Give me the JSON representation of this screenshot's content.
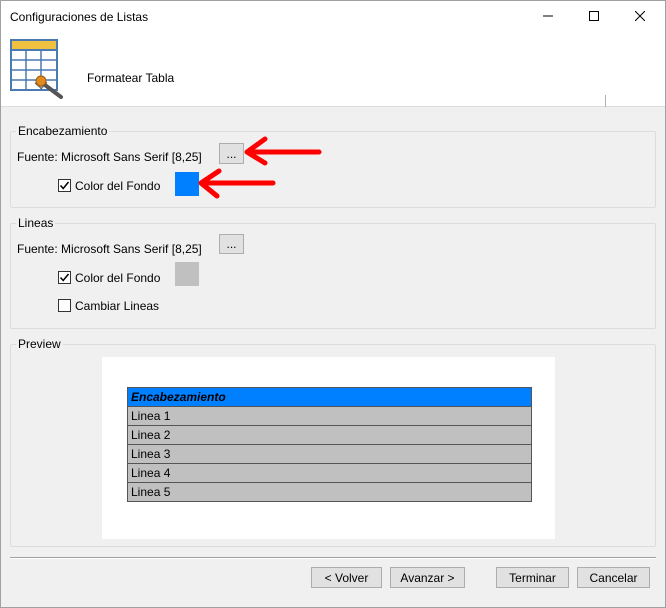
{
  "window": {
    "title": "Configuraciones de Listas",
    "header_title": "Formatear Tabla"
  },
  "encabezamiento": {
    "group_label": "Encabezamiento",
    "font_label": "Fuente: Microsoft Sans Serif [8,25]",
    "font_button": "...",
    "bg_checkbox_label": "Color del Fondo",
    "bg_checked": true,
    "bg_color": "#0080ff"
  },
  "lineas": {
    "group_label": "Lineas",
    "font_label": "Fuente:  Microsoft Sans Serif [8,25]",
    "font_button": "...",
    "bg_checkbox_label": "Color del Fondo",
    "bg_checked": true,
    "bg_color": "#c0c0c0",
    "change_lines_label": "Cambiar Lineas",
    "change_lines_checked": false
  },
  "preview": {
    "group_label": "Preview",
    "header_row": "Encabezamiento",
    "rows": [
      "Linea 1",
      "Linea 2",
      "Linea 3",
      "Linea 4",
      "Linea 5"
    ],
    "header_color": "#0080ff",
    "row_color": "#c0c0c0"
  },
  "footer": {
    "back": "< Volver",
    "next": "Avanzar >",
    "finish": "Terminar",
    "cancel": "Cancelar"
  },
  "annotations": {
    "arrow_color": "#ff0000"
  }
}
